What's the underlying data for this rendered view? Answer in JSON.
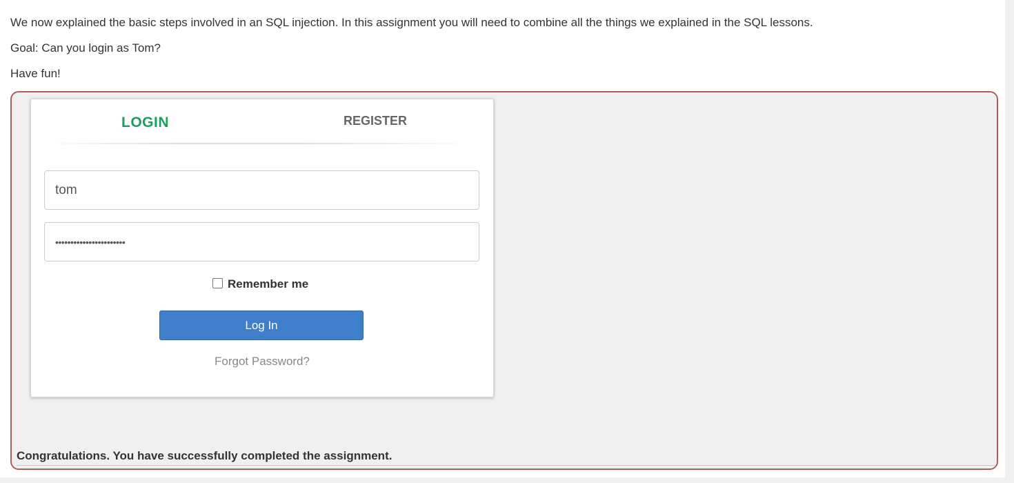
{
  "intro": {
    "paragraph_1": "We now explained the basic steps involved in an SQL injection. In this assignment you will need to combine all the things we explained in the SQL lessons.",
    "paragraph_2": "Goal: Can you login as Tom?",
    "paragraph_3": "Have fun!"
  },
  "login_panel": {
    "tabs": {
      "login": "LOGIN",
      "register": "REGISTER"
    },
    "active_tab": "login",
    "username_value": "tom",
    "password_masked": "•••••••••••••••••••••••",
    "remember_me_label": "Remember me",
    "remember_me_checked": false,
    "login_button_label": "Log In",
    "forgot_password_label": "Forgot Password?"
  },
  "feedback": {
    "message": "Congratulations. You have successfully completed the assignment."
  },
  "colors": {
    "active_tab": "#1aa05a",
    "login_button": "#3e7ecb",
    "assignment_border": "#b05d5d"
  }
}
